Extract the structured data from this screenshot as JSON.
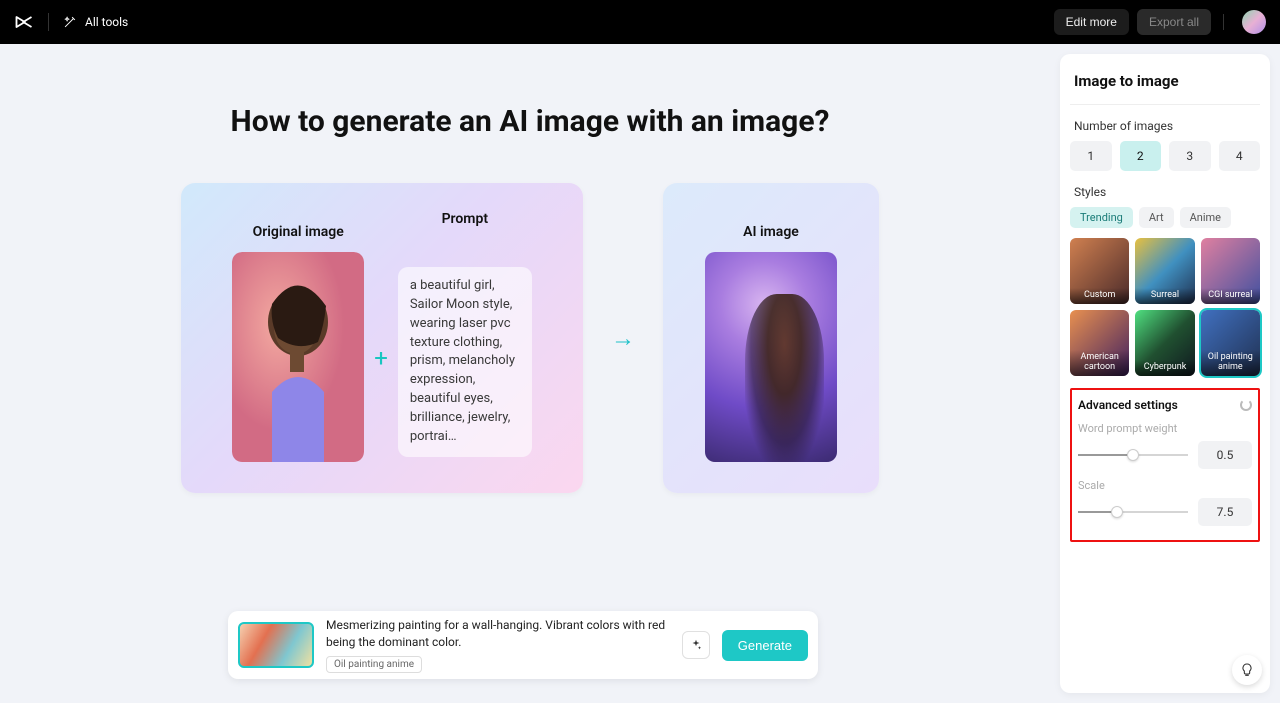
{
  "topbar": {
    "all_tools": "All tools",
    "edit_more": "Edit more",
    "export_all": "Export all"
  },
  "page": {
    "title": "How to generate an AI image with an image?"
  },
  "cards": {
    "original_label": "Original image",
    "prompt_label": "Prompt",
    "prompt_text": "a beautiful girl, Sailor Moon style, wearing laser pvc texture clothing, prism, melancholy expression, beautiful eyes, brilliance, jewelry, portrai…",
    "ai_label": "AI image"
  },
  "prompt_bar": {
    "text": "Mesmerizing painting for a wall-hanging. Vibrant colors with red being the dominant color.",
    "tag": "Oil painting anime",
    "generate": "Generate"
  },
  "sidebar": {
    "title": "Image to image",
    "num_label": "Number of images",
    "numbers": [
      "1",
      "2",
      "3",
      "4"
    ],
    "num_selected": 1,
    "styles_label": "Styles",
    "style_tabs": [
      "Trending",
      "Art",
      "Anime"
    ],
    "style_tab_selected": 0,
    "style_cells": [
      "Custom",
      "Surreal",
      "CGI surreal",
      "American cartoon",
      "Cyberpunk",
      "Oil painting anime"
    ],
    "style_selected": 5,
    "adv_title": "Advanced settings",
    "weight_label": "Word prompt weight",
    "weight_value": "0.5",
    "scale_label": "Scale",
    "scale_value": "7.5"
  }
}
